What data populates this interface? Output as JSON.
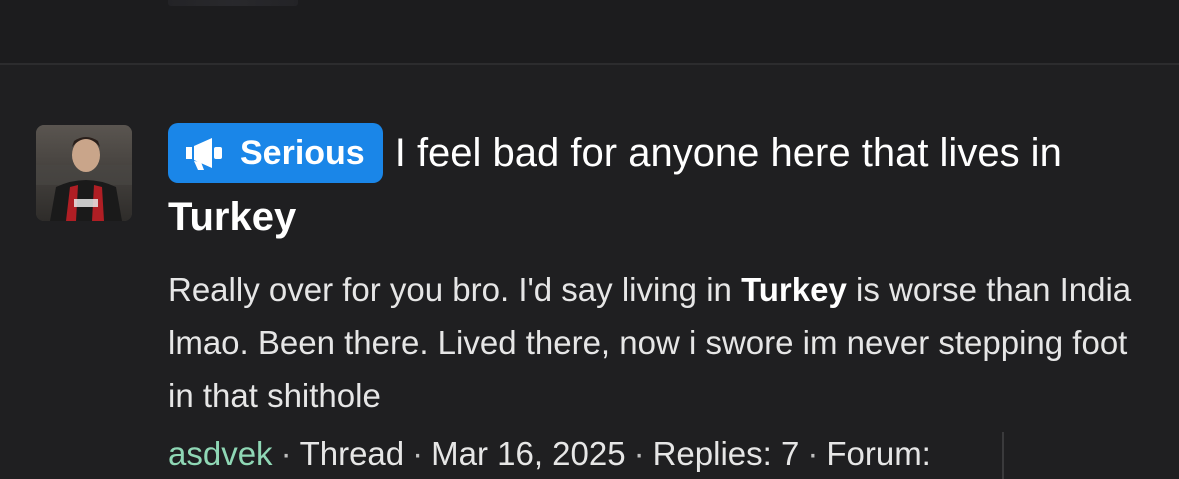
{
  "thread": {
    "prefix_label": "Serious",
    "prefix_icon": "megaphone-icon",
    "title_before": "I feel bad for anyone here that lives in ",
    "title_highlight": "Turkey",
    "snippet_before": "Really over for you bro. I'd say living in ",
    "snippet_highlight": "Turkey",
    "snippet_after": " is worse than India lmao. Been there. Lived there, now i swore im never stepping foot in that shithole",
    "author": "asdvek",
    "type": "Thread",
    "date": "Mar 16, 2025",
    "replies": "Replies: 7",
    "forum": "Forum:"
  },
  "colors": {
    "badge_bg": "#1a86e8",
    "username": "#8fd7b5",
    "background": "#1f1f21"
  }
}
